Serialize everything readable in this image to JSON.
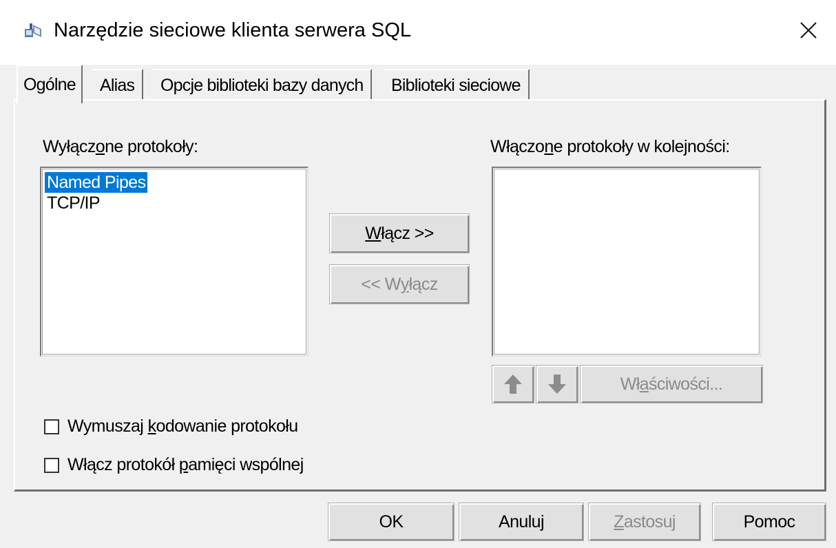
{
  "window": {
    "title": "Narzędzie sieciowe klienta serwera SQL"
  },
  "tabs": [
    {
      "label": "Ogólne",
      "active": true
    },
    {
      "label": "Alias",
      "active": false
    },
    {
      "label": "Opcje biblioteki bazy danych",
      "active": false
    },
    {
      "label": "Biblioteki sieciowe",
      "active": false
    }
  ],
  "disabled_protocols": {
    "label_pre": "Wyłącz",
    "label_key": "o",
    "label_post": "ne protokoły:",
    "items": [
      "Named Pipes",
      "TCP/IP"
    ],
    "selected": "Named Pipes"
  },
  "enabled_protocols": {
    "label_pre": "Włączo",
    "label_key": "n",
    "label_post": "e protokoły w kolejności:",
    "items": []
  },
  "enable_button": {
    "key": "W",
    "rest": "łącz >>"
  },
  "disable_button": {
    "pre": "<< W",
    "key": "y",
    "post": "łącz"
  },
  "properties_button": {
    "pre": "Wł",
    "key": "a",
    "post": "ściwości..."
  },
  "force_encryption": {
    "pre": "Wymuszaj ",
    "key": "k",
    "post": "odowanie protokołu",
    "checked": false
  },
  "shared_memory": {
    "pre": "Włącz protokół ",
    "key": "p",
    "post": "amięci wspólnej",
    "checked": false
  },
  "footer": {
    "ok": "OK",
    "cancel": "Anuluj",
    "apply_key": "Z",
    "apply_rest": "astosuj",
    "help": "Pomoc"
  },
  "icons": {
    "app": "network-utility-icon",
    "close": "close-icon",
    "up": "arrow-up-icon",
    "down": "arrow-down-icon"
  },
  "colors": {
    "selection": "#0078d7",
    "disabled_text": "#8a8a8a",
    "arrow": "#8c8c8c"
  }
}
